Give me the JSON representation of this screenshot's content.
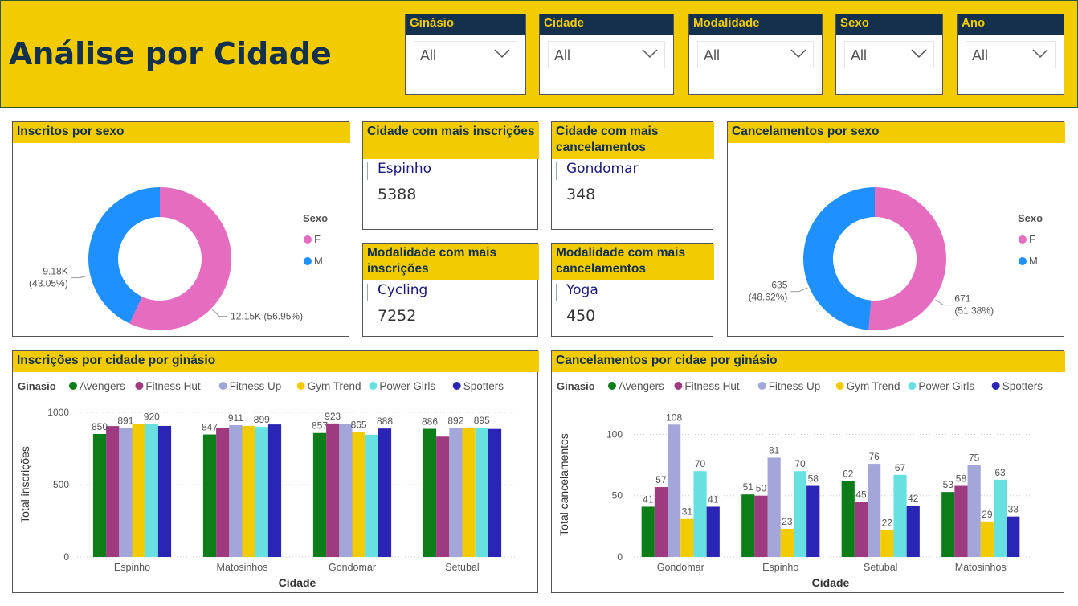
{
  "page": {
    "title": "Análise por Cidade"
  },
  "slicers": [
    {
      "label": "Ginásio",
      "value": "All"
    },
    {
      "label": "Cidade",
      "value": "All"
    },
    {
      "label": "Modalidade",
      "value": "All"
    },
    {
      "label": "Sexo",
      "value": "All"
    },
    {
      "label": "Ano",
      "value": "All"
    }
  ],
  "cards": [
    {
      "title": "Cidade com mais inscrições",
      "name": "Espinho",
      "value": "5388"
    },
    {
      "title": "Cidade com mais cancelamentos",
      "name": "Gondomar",
      "value": "348"
    },
    {
      "title": "Modalidade com mais inscrições",
      "name": "Cycling",
      "value": "7252"
    },
    {
      "title": "Modalidade com mais cancelamentos",
      "name": "Yoga",
      "value": "450"
    }
  ],
  "colors": {
    "F": "#e66cc0",
    "M": "#1e90ff",
    "Avengers": "#0d7d1a",
    "Fitness Hut": "#9e3a7f",
    "Fitness Up": "#a3a6d8",
    "Gym Trend": "#f2cc00",
    "Power Girls": "#66e0e0",
    "Spotters": "#2a25b5",
    "accent": "#f2cc00",
    "title": "#13304d"
  },
  "chart_data": [
    {
      "type": "pie",
      "title": "Inscritos por sexo",
      "legend_title": "Sexo",
      "legend_position": "right",
      "slices": [
        {
          "name": "F",
          "value": 12150,
          "label": "12.15K (56.95%)"
        },
        {
          "name": "M",
          "value": 9180,
          "label": "9.18K (43.05%)"
        }
      ]
    },
    {
      "type": "pie",
      "title": "Cancelamentos por sexo",
      "legend_title": "Sexo",
      "legend_position": "right",
      "slices": [
        {
          "name": "F",
          "value": 671,
          "label": "671 (51.38%)"
        },
        {
          "name": "M",
          "value": 635,
          "label": "635 (48.62%)"
        }
      ]
    },
    {
      "type": "bar",
      "title": "Inscrições por cidade por ginásio",
      "legend_title": "Ginasio",
      "legend_position": "top",
      "xlabel": "Cidade",
      "ylabel": "Total inscrições",
      "ylim": [
        0,
        1000
      ],
      "yticks": [
        0,
        500,
        1000
      ],
      "grid": true,
      "categories": [
        "Espinho",
        "Matosinhos",
        "Gondomar",
        "Setubal"
      ],
      "series": [
        {
          "name": "Avengers",
          "values": [
            850,
            847,
            857,
            886
          ]
        },
        {
          "name": "Fitness Hut",
          "values": [
            905,
            893,
            923,
            832
          ]
        },
        {
          "name": "Fitness Up",
          "values": [
            891,
            911,
            918,
            892
          ]
        },
        {
          "name": "Gym Trend",
          "values": [
            920,
            906,
            865,
            891
          ]
        },
        {
          "name": "Power Girls",
          "values": [
            920,
            899,
            845,
            895
          ]
        },
        {
          "name": "Spotters",
          "values": [
            906,
            916,
            888,
            885
          ]
        }
      ],
      "data_labels": [
        {
          "category": 0,
          "series": 0,
          "text": "850"
        },
        {
          "category": 0,
          "series": 2,
          "text": "891"
        },
        {
          "category": 0,
          "series": 4,
          "text": "920"
        },
        {
          "category": 1,
          "series": 0,
          "text": "847"
        },
        {
          "category": 1,
          "series": 2,
          "text": "911"
        },
        {
          "category": 1,
          "series": 4,
          "text": "899"
        },
        {
          "category": 2,
          "series": 0,
          "text": "857"
        },
        {
          "category": 2,
          "series": 1,
          "text": "923"
        },
        {
          "category": 2,
          "series": 3,
          "text": "865"
        },
        {
          "category": 2,
          "series": 5,
          "text": "888"
        },
        {
          "category": 3,
          "series": 0,
          "text": "886"
        },
        {
          "category": 3,
          "series": 2,
          "text": "892"
        },
        {
          "category": 3,
          "series": 4,
          "text": "895"
        }
      ]
    },
    {
      "type": "bar",
      "title": "Cancelamentos por cidae por ginásio",
      "legend_title": "Ginasio",
      "legend_position": "top",
      "xlabel": "Cidade",
      "ylabel": "Total cancelamentos",
      "ylim": [
        0,
        118
      ],
      "yticks": [
        0,
        50,
        100
      ],
      "grid": true,
      "categories": [
        "Gondomar",
        "Espinho",
        "Setubal",
        "Matosinhos"
      ],
      "series": [
        {
          "name": "Avengers",
          "values": [
            41,
            51,
            62,
            53
          ]
        },
        {
          "name": "Fitness Hut",
          "values": [
            57,
            50,
            45,
            58
          ]
        },
        {
          "name": "Fitness Up",
          "values": [
            108,
            81,
            76,
            75
          ]
        },
        {
          "name": "Gym Trend",
          "values": [
            31,
            23,
            22,
            29
          ]
        },
        {
          "name": "Power Girls",
          "values": [
            70,
            70,
            67,
            63
          ]
        },
        {
          "name": "Spotters",
          "values": [
            41,
            58,
            42,
            33
          ]
        }
      ]
    }
  ]
}
